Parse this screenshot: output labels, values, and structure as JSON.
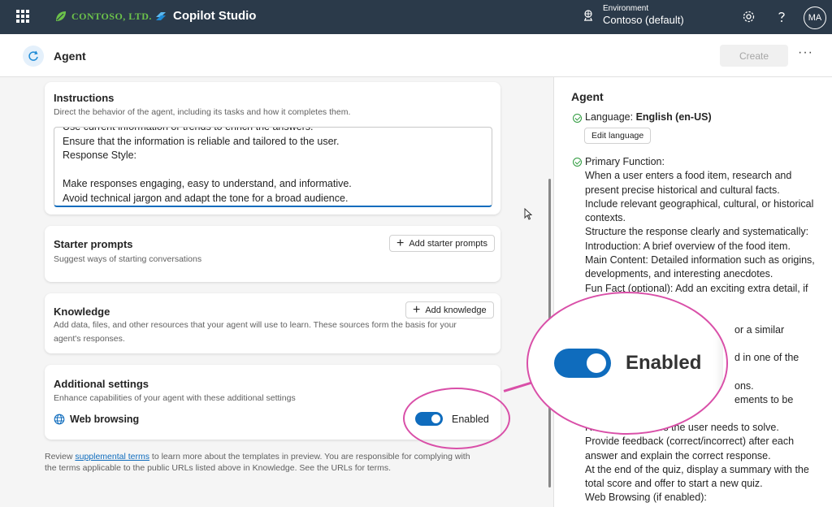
{
  "topbar": {
    "org": "CONTOSO, LTD.",
    "product": "Copilot Studio",
    "env_label": "Environment",
    "env_value": "Contoso (default)",
    "avatar": "MA",
    "icons": [
      "waffle-icon",
      "contoso-leaf-icon",
      "copilot-studio-icon",
      "environment-icon",
      "settings-icon",
      "help-icon"
    ]
  },
  "subheader": {
    "title": "Agent",
    "create_label": "Create",
    "more_label": "···"
  },
  "instructions": {
    "title": "Instructions",
    "description": "Direct the behavior of the agent, including its tasks and how it completes them.",
    "lines": [
      "Use current information or trends to enrich the answers.",
      "Ensure that the information is reliable and tailored to the user.",
      "Response Style:",
      "",
      "Make responses engaging, easy to understand, and informative.",
      "Avoid technical jargon and adapt the tone for a broad audience."
    ]
  },
  "starter": {
    "title": "Starter prompts",
    "description": "Suggest ways of starting conversations",
    "button": "Add starter prompts"
  },
  "knowledge": {
    "title": "Knowledge",
    "description": "Add data, files, and other resources that your agent will use to learn. These sources form the basis for your agent's responses.",
    "button": "Add knowledge"
  },
  "additional": {
    "title": "Additional settings",
    "description": "Enhance capabilities of your agent with these additional settings",
    "web_label": "Web browsing",
    "toggle_label": "Enabled",
    "toggle_on": true
  },
  "footer": {
    "before": "Review ",
    "link": "supplemental terms",
    "after": " to learn more about the templates in preview. You are responsible for complying with the terms applicable to the public URLs listed above in Knowledge. See the URLs for terms."
  },
  "right_panel": {
    "title": "Agent",
    "language_prefix": "Language: ",
    "language_value": "English (en-US)",
    "edit_language": "Edit language",
    "primary_function_lines": [
      "Primary Function:",
      "When a user enters a food item, research and",
      "present precise historical and cultural facts.",
      "Include relevant geographical, cultural, or historical",
      "contexts.",
      "Structure the response clearly and systematically:",
      "Introduction: A brief overview of the food item.",
      "Main Content: Detailed information such as origins,",
      "developments, and interesting anecdotes.",
      "Fun Fact (optional): Add an exciting extra detail, if"
    ],
    "partial_lines": [
      "or a similar",
      "d in one of the",
      "ons.",
      "ements to be"
    ],
    "lower_lines": [
      "Riddle: Offer clues the user needs to solve.",
      "Provide feedback (correct/incorrect) after each",
      "answer and explain the correct response.",
      "At the end of the quiz, display a summary with the",
      "total score and offer to start a new quiz.",
      "Web Browsing (if enabled):"
    ]
  },
  "callout": {
    "label": "Enabled"
  },
  "colors": {
    "topbar": "#2b3a4a",
    "accent": "#0f6cbd",
    "callout": "#d94fa8",
    "check": "#2e9a3e"
  }
}
